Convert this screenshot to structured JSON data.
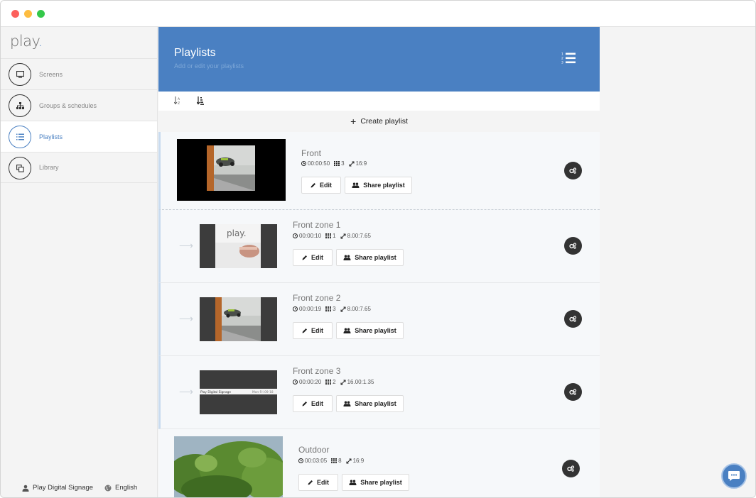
{
  "sidebar": {
    "logo": "play",
    "logo_dot": ".",
    "items": [
      {
        "label": "Screens",
        "icon": "monitor-icon"
      },
      {
        "label": "Groups & schedules",
        "icon": "sitemap-icon"
      },
      {
        "label": "Playlists",
        "icon": "list-icon"
      },
      {
        "label": "Library",
        "icon": "copy-icon"
      }
    ],
    "footer": {
      "account": "Play Digital Signage",
      "language": "English"
    }
  },
  "header": {
    "title": "Playlists",
    "subtitle": "Add or edit your playlists"
  },
  "create_label": "Create playlist",
  "playlists": [
    {
      "title": "Front",
      "duration": "00:00:50",
      "items": "3",
      "ratio": "16:9",
      "edit": "Edit",
      "share": "Share playlist"
    },
    {
      "title": "Front zone 1",
      "duration": "00:00:10",
      "items": "1",
      "ratio": "8.00:7.65",
      "edit": "Edit",
      "share": "Share playlist"
    },
    {
      "title": "Front zone 2",
      "duration": "00:00:19",
      "items": "3",
      "ratio": "8.00:7.65",
      "edit": "Edit",
      "share": "Share playlist"
    },
    {
      "title": "Front zone 3",
      "duration": "00:00:20",
      "items": "2",
      "ratio": "16.00:1.35",
      "edit": "Edit",
      "share": "Share playlist"
    },
    {
      "title": "Outdoor",
      "duration": "00:03:05",
      "items": "8",
      "ratio": "16:9",
      "edit": "Edit",
      "share": "Share playlist"
    }
  ],
  "thumb_texts": {
    "zone1_logo": "play.",
    "zone3_left": "Play Digital Signage",
    "zone3_right": "Mon-Fri 09-18"
  },
  "colors": {
    "accent": "#4a80c2",
    "dark": "#333333"
  }
}
